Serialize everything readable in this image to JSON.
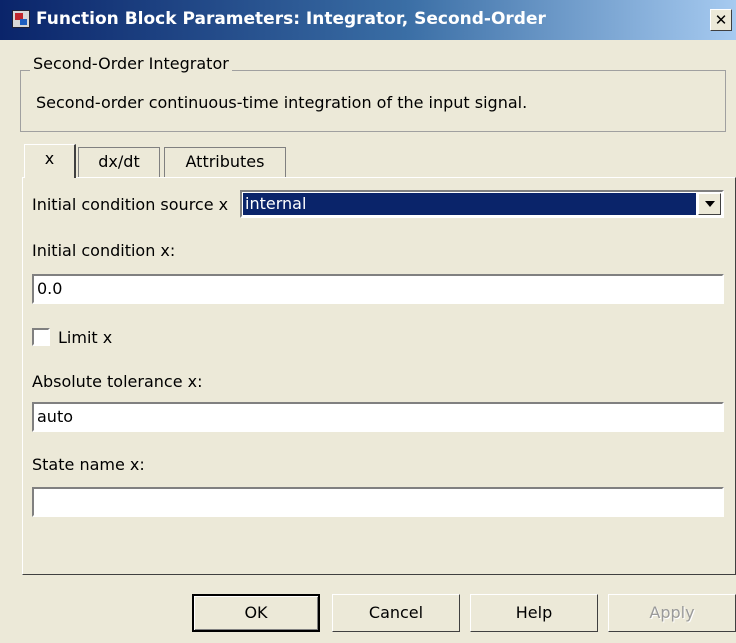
{
  "window": {
    "title": "Function Block Parameters: Integrator, Second-Order",
    "close_glyph": "✕",
    "icon_name": "simulink-block-icon"
  },
  "group": {
    "legend": "Second-Order Integrator",
    "description": "Second-order continuous-time integration of the input signal."
  },
  "tabs": [
    {
      "label": "x",
      "active": true
    },
    {
      "label": "dx/dt",
      "active": false
    },
    {
      "label": "Attributes",
      "active": false
    }
  ],
  "params": {
    "ic_source_label": "Initial condition source x",
    "ic_source_value": "internal",
    "ic_label": "Initial condition x:",
    "ic_value": "0.0",
    "limit_label": "Limit x",
    "limit_checked": false,
    "abstol_label": "Absolute tolerance x:",
    "abstol_value": "auto",
    "statename_label": "State name x:",
    "statename_value": ""
  },
  "buttons": {
    "ok": "OK",
    "cancel": "Cancel",
    "help": "Help",
    "apply": "Apply"
  }
}
